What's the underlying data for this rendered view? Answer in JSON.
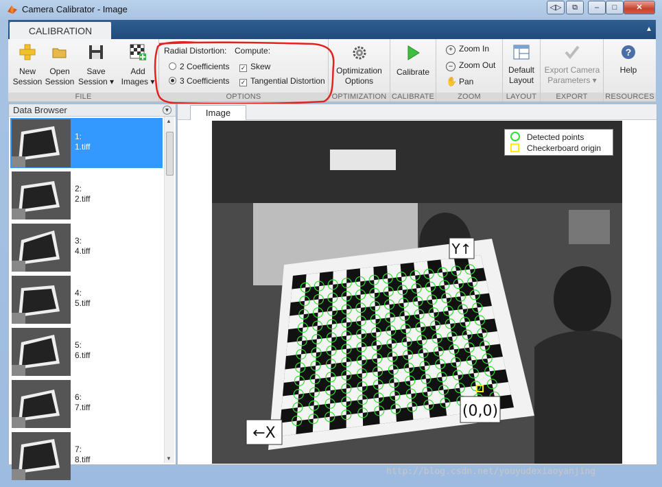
{
  "window": {
    "title": "Camera Calibrator - Image",
    "controls": [
      "◁▷",
      "⧉",
      "–",
      "□",
      "✕"
    ]
  },
  "toolstrip": {
    "tab": "CALIBRATION",
    "file": {
      "label": "FILE",
      "new_session": [
        "New",
        "Session"
      ],
      "open_session": [
        "Open",
        "Session"
      ],
      "save_session": [
        "Save",
        "Session ▾"
      ],
      "add_images": [
        "Add",
        "Images ▾"
      ]
    },
    "options": {
      "label": "OPTIONS",
      "radial_title": "Radial Distortion:",
      "coef2": "2 Coefficients",
      "coef3": "3 Coefficients",
      "selected_radial": "3 Coefficients",
      "compute_title": "Compute:",
      "skew": "Skew",
      "skew_checked": true,
      "tangential": "Tangential Distortion",
      "tangential_checked": true
    },
    "optimization": {
      "label": "OPTIMIZATION",
      "button": [
        "Optimization",
        "Options"
      ]
    },
    "calibrate": {
      "label": "CALIBRATE",
      "button": "Calibrate"
    },
    "zoom": {
      "label": "ZOOM",
      "zoom_in": "Zoom In",
      "zoom_out": "Zoom Out",
      "pan": "Pan"
    },
    "layout": {
      "label": "LAYOUT",
      "button": [
        "Default",
        "Layout"
      ]
    },
    "export": {
      "label": "EXPORT",
      "button": [
        "Export Camera",
        "Parameters ▾"
      ]
    },
    "resources": {
      "label": "RESOURCES",
      "button": "Help"
    }
  },
  "data_browser": {
    "title": "Data Browser",
    "items": [
      {
        "index": "1:",
        "file": "1.tiff",
        "selected": true
      },
      {
        "index": "2:",
        "file": "2.tiff",
        "selected": false
      },
      {
        "index": "3:",
        "file": "4.tiff",
        "selected": false
      },
      {
        "index": "4:",
        "file": "5.tiff",
        "selected": false
      },
      {
        "index": "5:",
        "file": "6.tiff",
        "selected": false
      },
      {
        "index": "6:",
        "file": "7.tiff",
        "selected": false
      },
      {
        "index": "7:",
        "file": "8.tiff",
        "selected": false
      }
    ]
  },
  "image_panel": {
    "tab": "Image",
    "legend": {
      "detected": "Detected points",
      "origin": "Checkerboard origin"
    },
    "labels": {
      "y_axis": "Y↑",
      "x_axis": "←X",
      "origin": "(0,0)"
    }
  },
  "colors": {
    "detected": "#33dd33",
    "origin": "#ffee00",
    "annotation": "#e0231e",
    "selection": "#3399ff"
  },
  "watermark": "http://blog.csdn.net/youyudexiaoyanjing"
}
